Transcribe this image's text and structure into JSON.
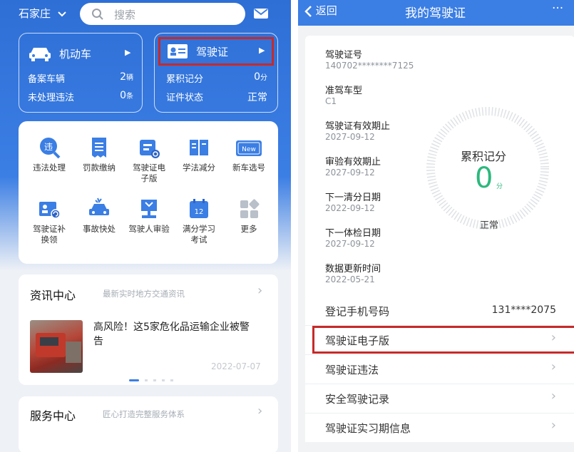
{
  "left": {
    "city": "石家庄",
    "search_placeholder": "搜索",
    "vehicle_card": {
      "title": "机动车",
      "rows": [
        {
          "label": "备案车辆",
          "value": "2",
          "unit": "辆"
        },
        {
          "label": "未处理违法",
          "value": "0",
          "unit": "条"
        }
      ]
    },
    "license_card": {
      "title": "驾驶证",
      "rows": [
        {
          "label": "累积记分",
          "value": "0",
          "unit": "分"
        },
        {
          "label": "证件状态",
          "value": "正常",
          "unit": ""
        }
      ]
    },
    "grid": [
      {
        "line1": "违法处理",
        "line2": "",
        "icon": "violation-icon"
      },
      {
        "line1": "罚款缴纳",
        "line2": "",
        "icon": "fine-receipt-icon"
      },
      {
        "line1": "驾驶证电",
        "line2": "子版",
        "icon": "e-license-icon"
      },
      {
        "line1": "学法减分",
        "line2": "",
        "icon": "book-icon"
      },
      {
        "line1": "新车选号",
        "line2": "",
        "icon": "new-plate-icon"
      },
      {
        "line1": "驾驶证补",
        "line2": "换领",
        "icon": "license-renew-icon"
      },
      {
        "line1": "事故快处",
        "line2": "",
        "icon": "accident-icon"
      },
      {
        "line1": "驾驶人审验",
        "line2": "",
        "icon": "driver-review-icon"
      },
      {
        "line1": "满分学习",
        "line2": "考试",
        "icon": "calendar-exam-icon"
      },
      {
        "line1": "更多",
        "line2": "",
        "icon": "more-icon"
      }
    ],
    "calendar_number": "12",
    "new_badge": "New",
    "grid_glyph": "违",
    "news": {
      "title": "资讯中心",
      "subtitle": "最新实时地方交通资讯",
      "headline": "高风险！这5家危化品运输企业被警告",
      "date": "2022-07-07"
    },
    "service": {
      "title": "服务中心",
      "subtitle": "匠心打造完整服务体系"
    }
  },
  "right": {
    "back": "返回",
    "title": "我的驾驶证",
    "more": "···",
    "fields": [
      {
        "label": "驾驶证号",
        "value": "140702********7125"
      },
      {
        "label": "准驾车型",
        "value": "C1"
      },
      {
        "label": "驾驶证有效期止",
        "value": "2027-09-12"
      },
      {
        "label": "审验有效期止",
        "value": "2027-09-12"
      },
      {
        "label": "下一清分日期",
        "value": "2022-09-12"
      },
      {
        "label": "下一体检日期",
        "value": "2027-09-12"
      },
      {
        "label": "数据更新时间",
        "value": "2022-05-21"
      }
    ],
    "gauge": {
      "title": "累积记分",
      "score": "0",
      "unit": "分",
      "status": "正常"
    },
    "phone": {
      "label": "登记手机号码",
      "value": "131****2075"
    },
    "rows": [
      {
        "label": "驾驶证电子版"
      },
      {
        "label": "驾驶证违法"
      },
      {
        "label": "安全驾驶记录"
      },
      {
        "label": "驾驶证实习期信息"
      }
    ],
    "colors": {
      "accent": "#3b7ee4",
      "highlight": "#c62a2a",
      "gauge": "#2db87d"
    }
  }
}
